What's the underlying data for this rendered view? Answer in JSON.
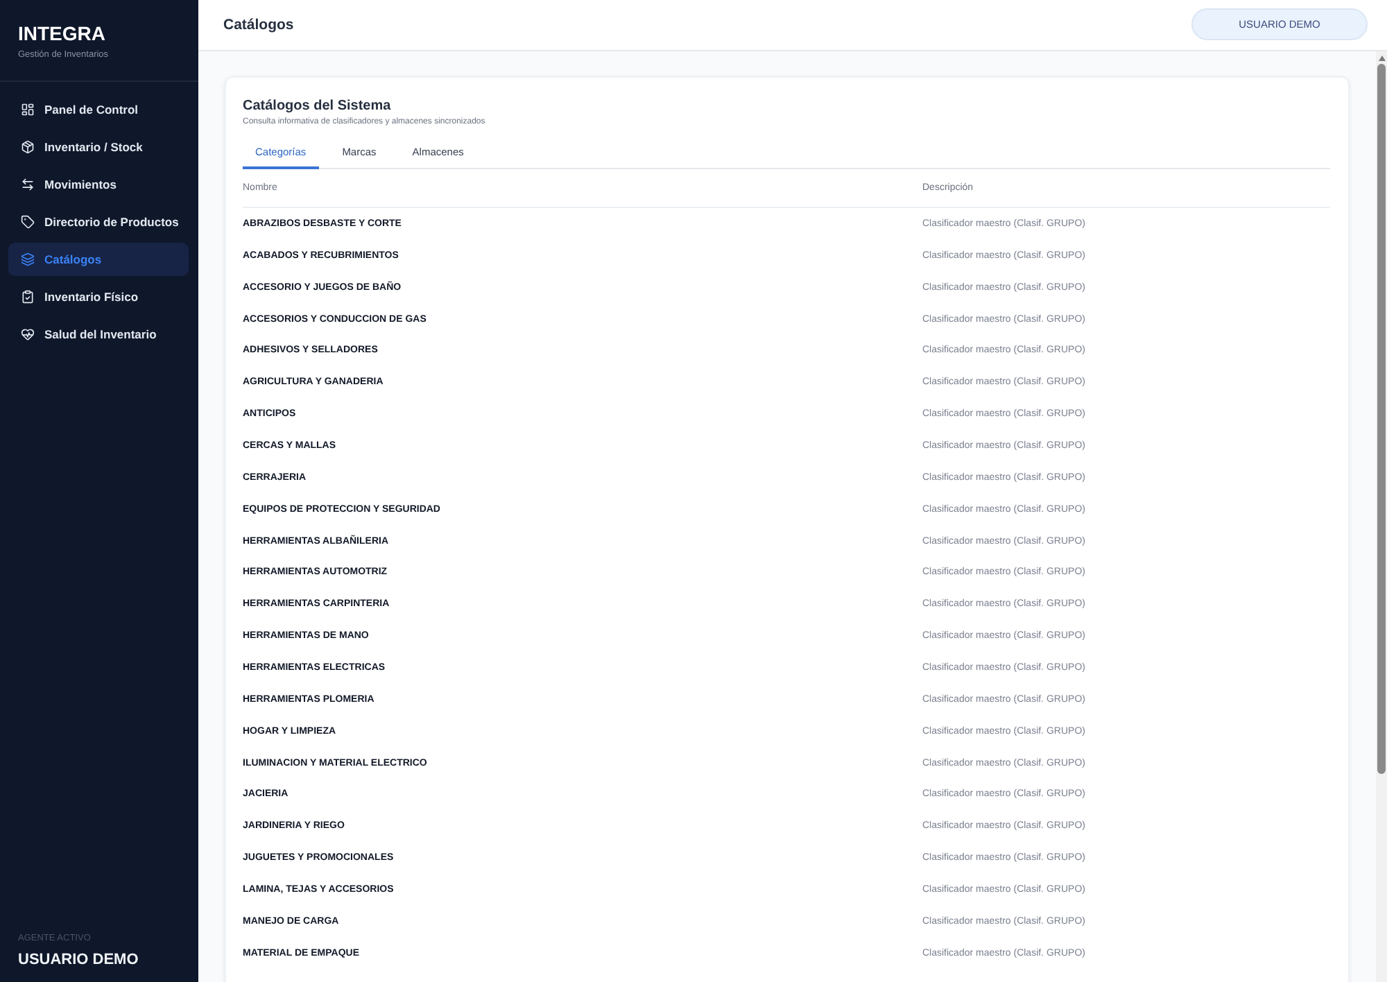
{
  "sidebar": {
    "brand": "INTEGRA",
    "subtitle": "Gestión de Inventarios",
    "items": [
      {
        "label": "Panel de Control",
        "selected": false
      },
      {
        "label": "Inventario / Stock",
        "selected": false
      },
      {
        "label": "Movimientos",
        "selected": false
      },
      {
        "label": "Directorio de Productos",
        "selected": false
      },
      {
        "label": "Catálogos",
        "selected": true
      },
      {
        "label": "Inventario Físico",
        "selected": false
      },
      {
        "label": "Salud del Inventario",
        "selected": false
      }
    ],
    "footer": {
      "caption": "AGENTE ACTIVO",
      "user": "USUARIO DEMO"
    }
  },
  "header": {
    "title": "Catálogos",
    "user_badge": "USUARIO DEMO"
  },
  "card": {
    "title": "Catálogos del Sistema",
    "subtitle": "Consulta informativa de clasificadores y almacenes sincronizados",
    "tabs": [
      {
        "label": "Categorías",
        "selected": true
      },
      {
        "label": "Marcas",
        "selected": false
      },
      {
        "label": "Almacenes",
        "selected": false
      }
    ],
    "table": {
      "columns": [
        "Nombre",
        "Descripción"
      ],
      "rows": [
        {
          "name": "ABRAZIBOS DESBASTE Y CORTE",
          "description": "Clasificador maestro (Clasif. GRUPO)"
        },
        {
          "name": "ACABADOS Y RECUBRIMIENTOS",
          "description": "Clasificador maestro (Clasif. GRUPO)"
        },
        {
          "name": "ACCESORIO Y JUEGOS DE BAÑO",
          "description": "Clasificador maestro (Clasif. GRUPO)"
        },
        {
          "name": "ACCESORIOS Y CONDUCCION DE GAS",
          "description": "Clasificador maestro (Clasif. GRUPO)"
        },
        {
          "name": "ADHESIVOS Y SELLADORES",
          "description": "Clasificador maestro (Clasif. GRUPO)"
        },
        {
          "name": "AGRICULTURA Y GANADERIA",
          "description": "Clasificador maestro (Clasif. GRUPO)"
        },
        {
          "name": "ANTICIPOS",
          "description": "Clasificador maestro (Clasif. GRUPO)"
        },
        {
          "name": "CERCAS Y MALLAS",
          "description": "Clasificador maestro (Clasif. GRUPO)"
        },
        {
          "name": "CERRAJERIA",
          "description": "Clasificador maestro (Clasif. GRUPO)"
        },
        {
          "name": "EQUIPOS DE PROTECCION Y SEGURIDAD",
          "description": "Clasificador maestro (Clasif. GRUPO)"
        },
        {
          "name": "HERRAMIENTAS ALBAÑILERIA",
          "description": "Clasificador maestro (Clasif. GRUPO)"
        },
        {
          "name": "HERRAMIENTAS AUTOMOTRIZ",
          "description": "Clasificador maestro (Clasif. GRUPO)"
        },
        {
          "name": "HERRAMIENTAS CARPINTERIA",
          "description": "Clasificador maestro (Clasif. GRUPO)"
        },
        {
          "name": "HERRAMIENTAS DE MANO",
          "description": "Clasificador maestro (Clasif. GRUPO)"
        },
        {
          "name": "HERRAMIENTAS ELECTRICAS",
          "description": "Clasificador maestro (Clasif. GRUPO)"
        },
        {
          "name": "HERRAMIENTAS PLOMERIA",
          "description": "Clasificador maestro (Clasif. GRUPO)"
        },
        {
          "name": "HOGAR Y LIMPIEZA",
          "description": "Clasificador maestro (Clasif. GRUPO)"
        },
        {
          "name": "ILUMINACION Y MATERIAL ELECTRICO",
          "description": "Clasificador maestro (Clasif. GRUPO)"
        },
        {
          "name": "JACIERIA",
          "description": "Clasificador maestro (Clasif. GRUPO)"
        },
        {
          "name": "JARDINERIA Y RIEGO",
          "description": "Clasificador maestro (Clasif. GRUPO)"
        },
        {
          "name": "JUGUETES Y PROMOCIONALES",
          "description": "Clasificador maestro (Clasif. GRUPO)"
        },
        {
          "name": "LAMINA, TEJAS Y ACCESORIOS",
          "description": "Clasificador maestro (Clasif. GRUPO)"
        },
        {
          "name": "MANEJO DE CARGA",
          "description": "Clasificador maestro (Clasif. GRUPO)"
        },
        {
          "name": "MATERIAL DE EMPAQUE",
          "description": "Clasificador maestro (Clasif. GRUPO)"
        }
      ]
    }
  }
}
